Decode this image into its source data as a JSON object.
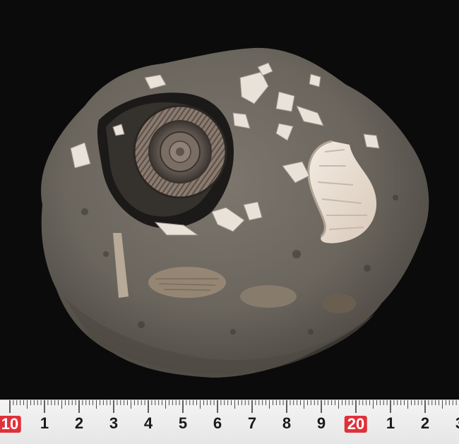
{
  "photo": {
    "subject": "ammonite-fossil-rock",
    "background_color": "#0b0b0b",
    "rock_color": "#6e6a63",
    "shell_color": "#e8ddd2"
  },
  "ruler": {
    "labels": [
      "10",
      "1",
      "2",
      "3",
      "4",
      "5",
      "6",
      "7",
      "8",
      "9",
      "20",
      "1",
      "2",
      "3"
    ],
    "highlighted_labels": [
      "10",
      "20"
    ],
    "highlight_color": "#e0303a"
  }
}
